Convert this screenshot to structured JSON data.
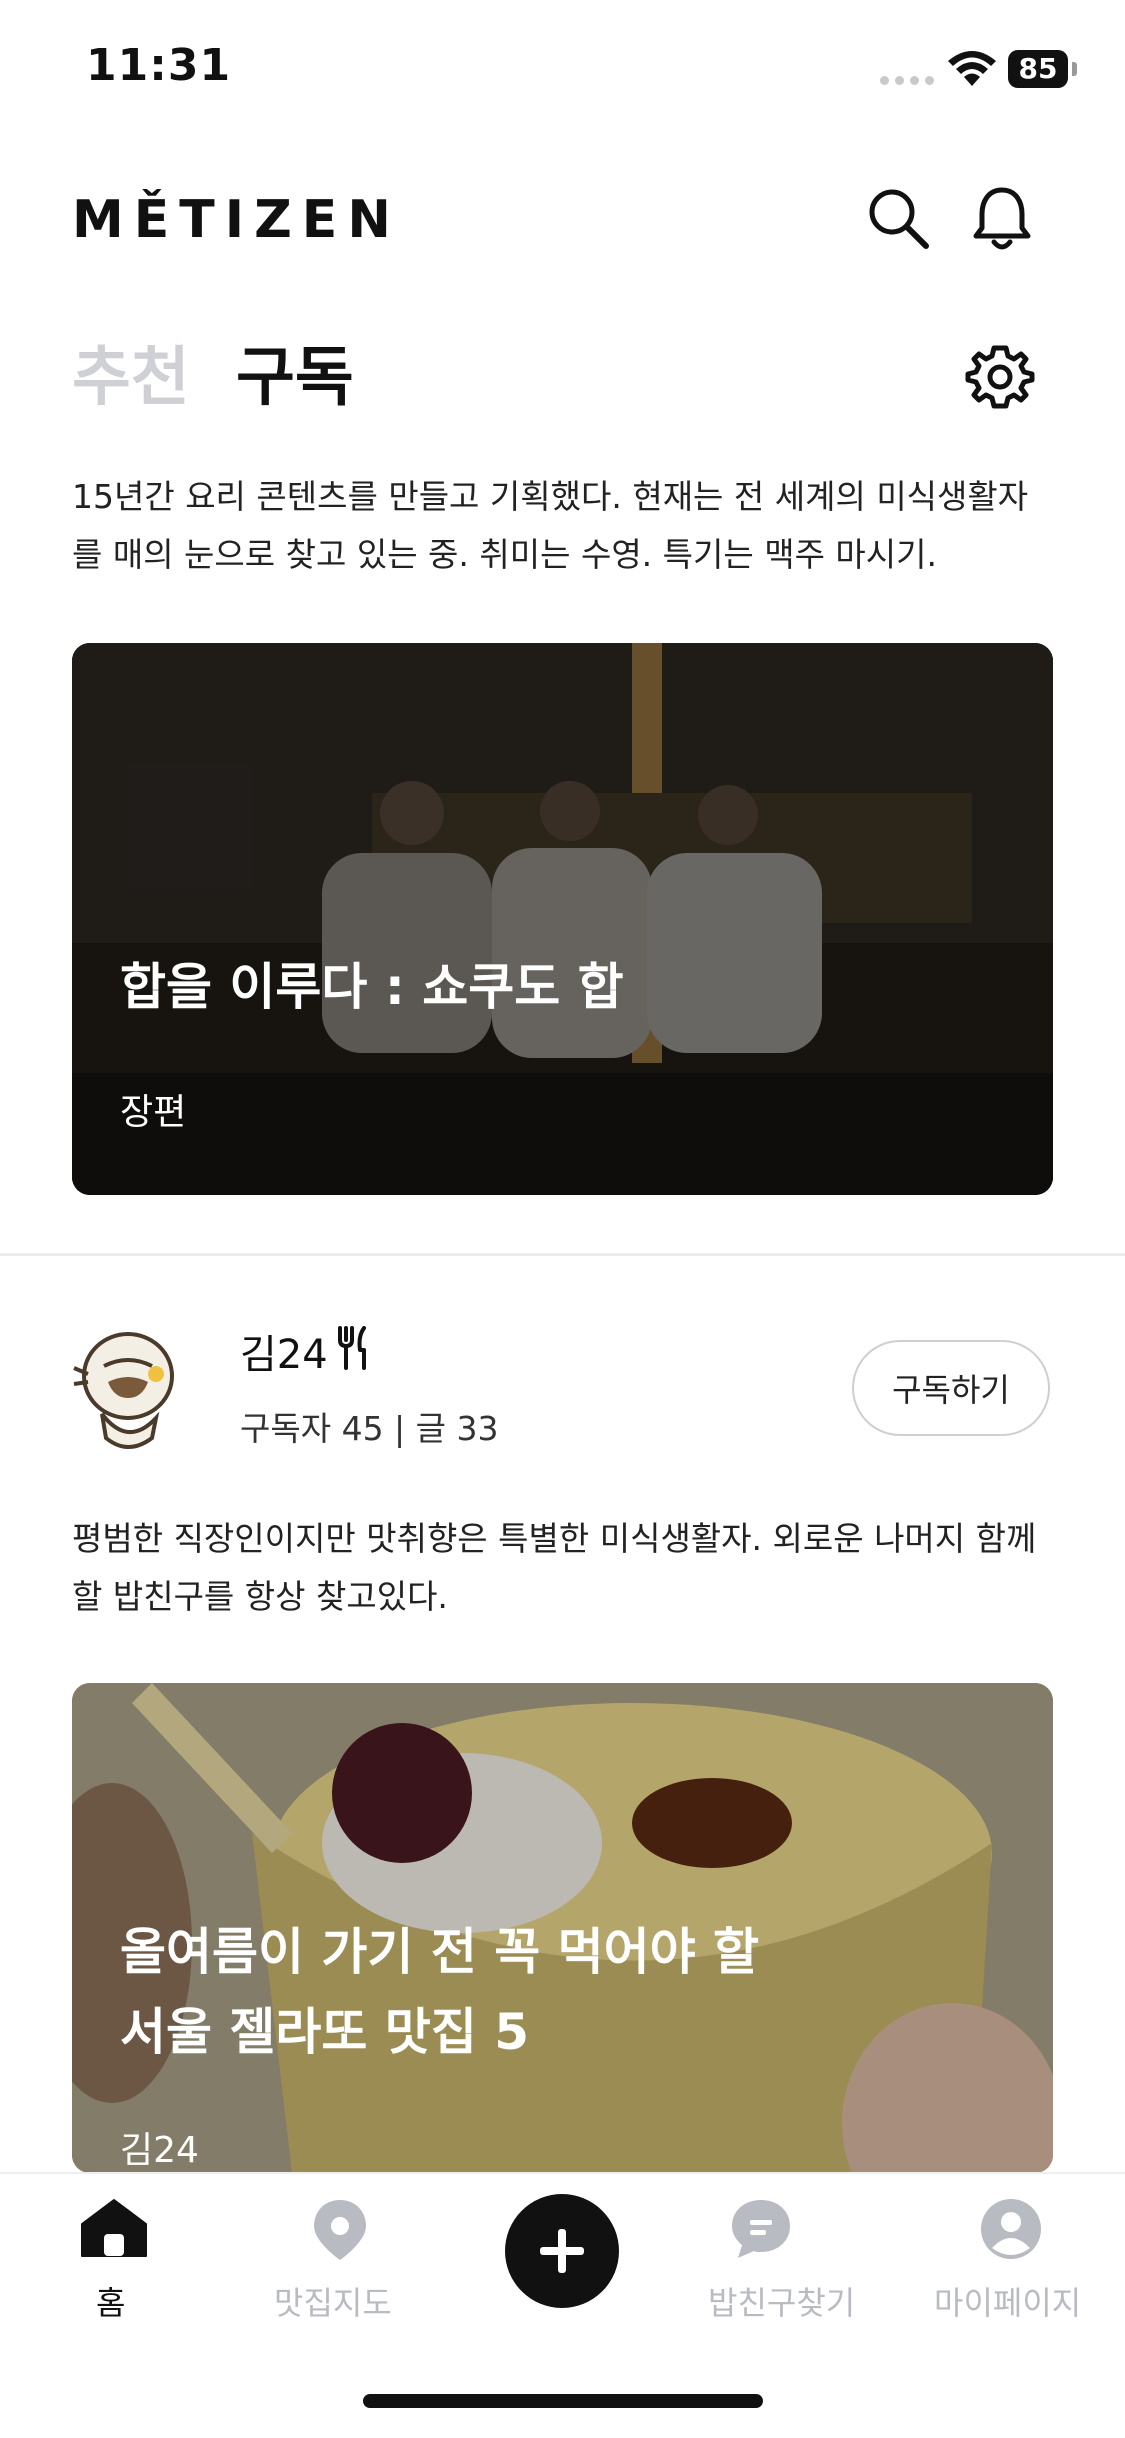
{
  "status_bar": {
    "time": "11:31",
    "battery": "85"
  },
  "header": {
    "logo": "MĚTIZEN"
  },
  "tabs": [
    {
      "label": "추천",
      "active": false
    },
    {
      "label": "구독",
      "active": true
    }
  ],
  "feed": {
    "intro_desc": "15년간 요리 콘텐츠를 만들고 기획했다. 현재는 전 세계의 미식생활자를 매의 눈으로 찾고 있는 중. 취미는 수영. 특기는 맥주 마시기.",
    "card1": {
      "title": "합을 이루다 : 쇼쿠도 합",
      "subtitle": "장편"
    },
    "author": {
      "name": "김24",
      "stats": "구독자 45 | 글 33",
      "subscribe_label": "구독하기",
      "desc": "평범한 직장인이지만 맛취향은 특별한 미식생활자. 외로운 나머지 함께할 밥친구를 항상 찾고있다."
    },
    "card2": {
      "title_line1": "올여름이 가기 전 꼭 먹어야 할",
      "title_line2": "서울 젤라또 맛집 5",
      "author": "김24"
    }
  },
  "bottom_nav": [
    {
      "label": "홈",
      "icon": "home-icon",
      "active": true
    },
    {
      "label": "맛집지도",
      "icon": "map-pin-icon",
      "active": false
    },
    {
      "label": "",
      "icon": "plus-icon",
      "active": false
    },
    {
      "label": "밥친구찾기",
      "icon": "chat-icon",
      "active": false
    },
    {
      "label": "마이페이지",
      "icon": "profile-icon",
      "active": false
    }
  ],
  "colors": {
    "active": "#111111",
    "inactive": "#b9bbc2",
    "tab_inactive": "#cfd0d6"
  }
}
